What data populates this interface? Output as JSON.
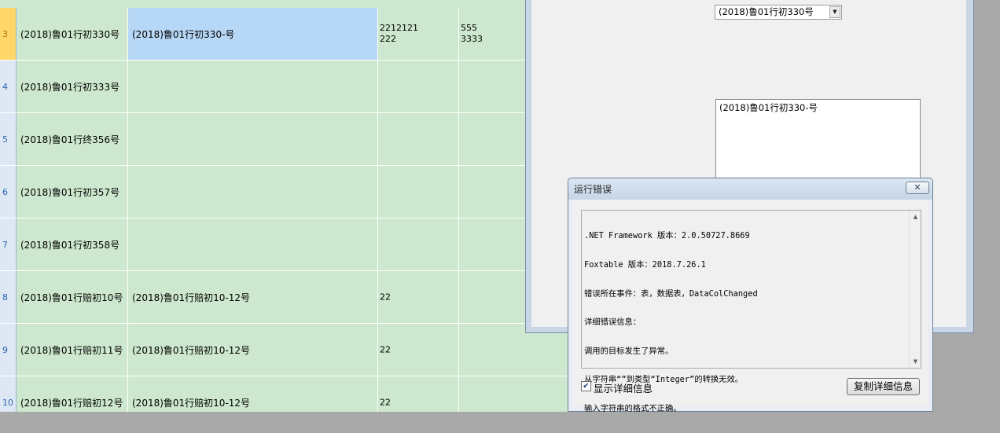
{
  "grid": {
    "rows": [
      {
        "num": "3",
        "c1": "(2018)鲁01行初330号",
        "c2": "(2018)鲁01行初330-号",
        "c3": [
          "2212121",
          "222"
        ],
        "c4": [
          "555",
          "3333"
        ],
        "current": true
      },
      {
        "num": "4",
        "c1": "(2018)鲁01行初333号",
        "c2": "",
        "c3": [],
        "c4": []
      },
      {
        "num": "5",
        "c1": "(2018)鲁01行终356号",
        "c2": "",
        "c3": [],
        "c4": []
      },
      {
        "num": "6",
        "c1": "(2018)鲁01行初357号",
        "c2": "",
        "c3": [],
        "c4": []
      },
      {
        "num": "7",
        "c1": "(2018)鲁01行初358号",
        "c2": "",
        "c3": [],
        "c4": []
      },
      {
        "num": "8",
        "c1": "(2018)鲁01行赔初10号",
        "c2": "(2018)鲁01行赔初10-12号",
        "c3": [
          "22"
        ],
        "c4": []
      },
      {
        "num": "9",
        "c1": "(2018)鲁01行赔初11号",
        "c2": "(2018)鲁01行赔初10-12号",
        "c3": [
          "22"
        ],
        "c4": []
      },
      {
        "num": "10",
        "c1": "(2018)鲁01行赔初12号",
        "c2": "(2018)鲁01行赔初10-12号",
        "c3": [
          "22"
        ],
        "c4": []
      }
    ]
  },
  "form": {
    "combo_value": "(2018)鲁01行初330号",
    "memo_value": "(2018)鲁01行初330-号"
  },
  "dialog": {
    "title": "运行错误",
    "close_glyph": "✕",
    "error_lines": [
      ".NET Framework 版本：2.0.50727.8669",
      "Foxtable 版本：2018.7.26.1",
      "错误所在事件：表，数据表，DataColChanged",
      "详细错误信息：",
      "调用的目标发生了异常。",
      "从字符串“”到类型“Integer”的转换无效。",
      "输入字符串的格式不正确。"
    ],
    "show_details_label": "显示详细信息",
    "show_details_checked": true,
    "copy_button_label": "复制详细信息"
  },
  "icons": {
    "combo_arrow": "chevron-down-icon",
    "dialog_close": "close-icon",
    "scroll_up": "scroll-up-icon",
    "scroll_down": "scroll-down-icon",
    "checkbox": "check-icon"
  },
  "colors": {
    "grid_background": "#cde8ce",
    "selected_cell": "#b6d7f6",
    "current_row_header": "#ffd768",
    "row_header": "#dde8f4"
  }
}
